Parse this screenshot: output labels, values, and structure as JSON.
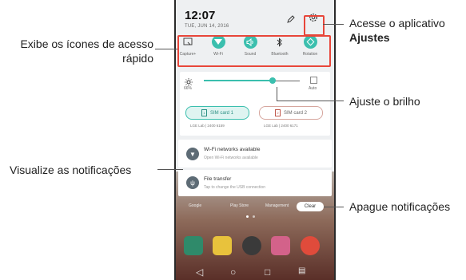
{
  "phone": {
    "time": "12:07",
    "date": "TUE, JUN 14, 2016",
    "quick_access": [
      "Capture+",
      "Wi-Fi",
      "Sound",
      "Bluetooth",
      "Rotation"
    ],
    "brightness_value": "66%",
    "brightness_level": 0.72,
    "auto_label": "Auto",
    "sim1": {
      "label": "SIM card 1",
      "carrier": "LGE Lab | 2400 6159"
    },
    "sim2": {
      "label": "SIM card 2",
      "carrier": "LGE Lab | 2400 6171"
    },
    "notifications": [
      {
        "title": "Wi-Fi networks available",
        "subtitle": "Open Wi-Fi networks available"
      },
      {
        "title": "File transfer",
        "subtitle": "Tap to change the USB connection"
      }
    ],
    "clear_label": "Clear",
    "home_labels": [
      "Google",
      "Play Store",
      "Management"
    ]
  },
  "callouts": {
    "settings_line1": "Acesse o aplicativo",
    "settings_line2": "Ajustes",
    "quick_line1": "Exibe os ícones de acesso",
    "quick_line2": "rápido",
    "brightness": "Ajuste o brilho",
    "notifications": "Visualize as notificações",
    "clear": "Apague notificações"
  },
  "colors": {
    "accent": "#3bbfae",
    "callout_box": "#e8463a"
  }
}
